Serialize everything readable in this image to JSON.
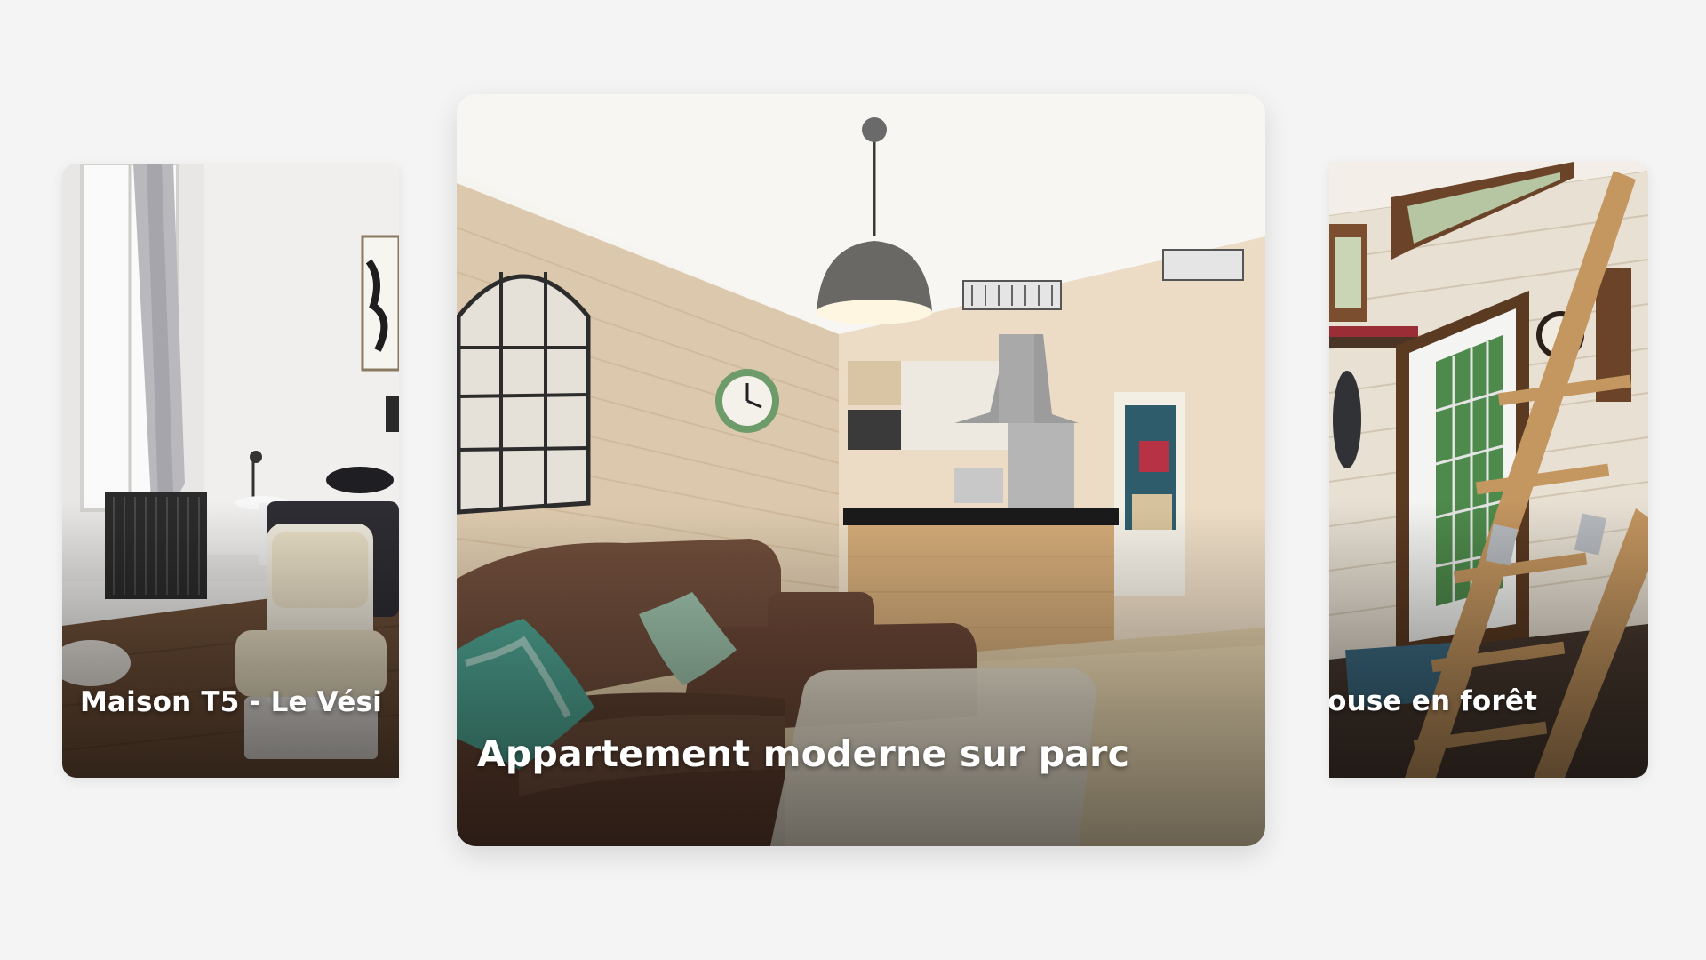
{
  "carousel": {
    "cards": [
      {
        "title": "Maison T5 - Le Vési"
      },
      {
        "title": "Appartement moderne sur parc"
      },
      {
        "title": "Tiny house en forêt"
      }
    ]
  },
  "colors": {
    "background": "#f4f4f4",
    "title_text": "#ffffff"
  }
}
